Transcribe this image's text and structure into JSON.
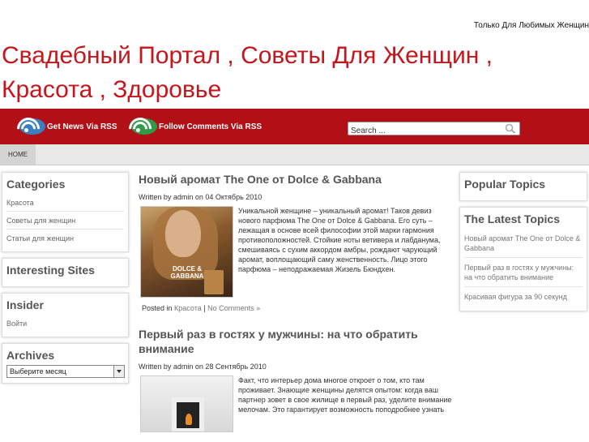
{
  "header": {
    "tagline": "Только Для Любимых Женщин",
    "site_title": "Свадебный Портал , Советы Для Женщин , Красота , Здоровье"
  },
  "rss": {
    "news": "Get News Via RSS",
    "comments": "Follow Comments Via RSS"
  },
  "search": {
    "placeholder": "Search ..."
  },
  "nav": {
    "home": "HOME"
  },
  "sidebar_left": {
    "categories": {
      "title": "Categories",
      "items": [
        "Красота",
        "Советы для женщин",
        "Статьи для женщин"
      ]
    },
    "interesting": {
      "title": "Interesting Sites"
    },
    "insider": {
      "title": "Insider",
      "items": [
        "Войти"
      ]
    },
    "archives": {
      "title": "Archives",
      "select_value": "Выберите месяц"
    }
  },
  "posts": [
    {
      "title": "Новый аромат The One от Dolce & Gabbana",
      "meta": "Written by admin on 04 Октябрь 2010",
      "thumb_brand": "DOLCE & GABBANA",
      "excerpt": "Уникальной женщине – уникальный аромат! Таков девиз нового парфюма The One от Dolce & Gabbana. Его суть – лежащая в основе всей философии этой марки гармония противоположностей. Стойкие ноты ветивера и лабданума, смешиваясь с сухим аккордом амбры, рождают чарующий аромат, воплощающий саму женственность. Лицо этого парфюма – неподражаемая Жизель Бюндхен.",
      "posted_prefix": "Posted in ",
      "category": "Красота",
      "separator": " | ",
      "comments": "No Comments »"
    },
    {
      "title": "Первый раз в гостях у мужчины: на что обратить внимание",
      "meta": "Written by admin on 28 Сентябрь 2010",
      "excerpt": "Факт, что интерьер дома многое откроет о том, кто там проживает. Знающие женщины делятся опытом: когда ваш партнер зовет в свое жилище в первый раз, уделите внимание мелочам. Это гарантирует возможность поподробнее узнать"
    }
  ],
  "sidebar_right": {
    "popular": {
      "title": "Popular Topics"
    },
    "latest": {
      "title": "The Latest Topics",
      "items": [
        "Новый аромат The One от Dolce & Gabbana",
        "Первый раз в гостях у мужчины: на что обратить внимание",
        "Красивая фигура за 90 секунд"
      ]
    }
  },
  "colors": {
    "brand_red": "#b21016",
    "title_red": "#c4161c",
    "rss_blue": "#3a7fc2",
    "rss_green": "#2f9a48"
  }
}
